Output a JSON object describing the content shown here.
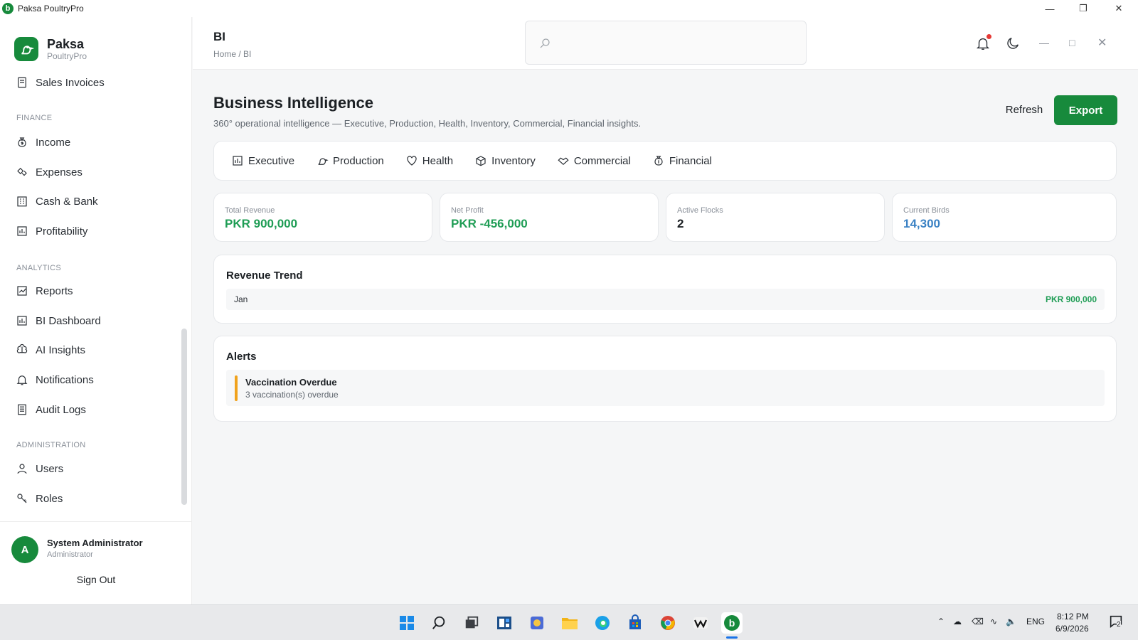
{
  "window": {
    "title": "Paksa PoultryPro"
  },
  "brand": {
    "name": "Paksa",
    "subtitle": "PoultryPro"
  },
  "sidebar": {
    "partial_item": "Sales Invoices",
    "sections": [
      {
        "label": "FINANCE",
        "items": [
          "Income",
          "Expenses",
          "Cash & Bank",
          "Profitability"
        ]
      },
      {
        "label": "ANALYTICS",
        "items": [
          "Reports",
          "BI Dashboard",
          "AI Insights",
          "Notifications",
          "Audit Logs"
        ]
      },
      {
        "label": "ADMINISTRATION",
        "items": [
          "Users",
          "Roles"
        ]
      }
    ]
  },
  "user": {
    "initial": "A",
    "name": "System Administrator",
    "role": "Administrator",
    "signout": "Sign Out"
  },
  "header": {
    "title": "BI",
    "breadcrumb": "Home  /  BI",
    "notification_badge_color": "#e53935"
  },
  "main": {
    "title": "Business Intelligence",
    "subtitle": "360° operational intelligence — Executive, Production, Health, Inventory, Commercial, Financial insights.",
    "refresh_label": "Refresh",
    "export_label": "Export",
    "tabs": [
      "Executive",
      "Production",
      "Health",
      "Inventory",
      "Commercial",
      "Financial"
    ],
    "kpis": [
      {
        "label": "Total Revenue",
        "value": "PKR 900,000",
        "color": "#1f9d55"
      },
      {
        "label": "Net Profit",
        "value": "PKR -456,000",
        "color": "#1f9d55"
      },
      {
        "label": "Active Flocks",
        "value": "2",
        "color": "#1b1f23"
      },
      {
        "label": "Current Birds",
        "value": "14,300",
        "color": "#3b82c4"
      }
    ],
    "revenue_trend": {
      "title": "Revenue Trend",
      "rows": [
        {
          "label": "Jan",
          "value": "PKR 900,000"
        }
      ]
    },
    "alerts": {
      "title": "Alerts",
      "items": [
        {
          "title": "Vaccination Overdue",
          "description": "3 vaccination(s) overdue",
          "color": "#f0a21c"
        }
      ]
    }
  },
  "taskbar": {
    "tray_lang": "ENG",
    "time": "8:12 PM",
    "date": "6/9/2026",
    "notification_count": "2",
    "accent": "#1a73e8"
  }
}
